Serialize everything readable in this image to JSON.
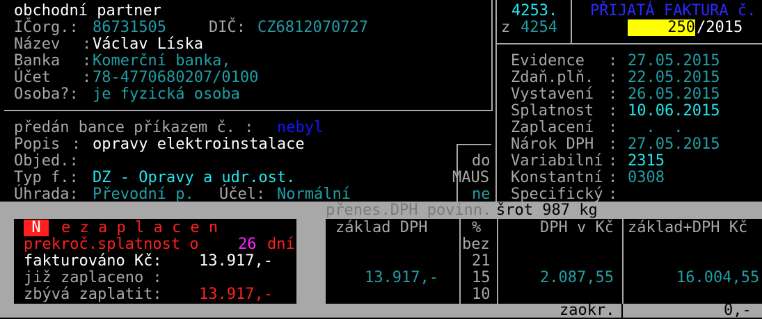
{
  "partner": {
    "heading": "obchodní partner",
    "ico_label": "IČorg.:",
    "ico_value": "86731505",
    "dic_label": "DIČ:",
    "dic_value": "CZ6812070727",
    "name_label": "Název",
    "name_sep": ":",
    "name_value": "Václav Líska",
    "bank_label": "Banka",
    "bank_sep": ":",
    "bank_value": "Komerční banka,",
    "account_label": "Účet",
    "account_sep": ":",
    "account_value": "78-4770680207/0100",
    "person_label": "Osoba?:",
    "person_value": "je fyzická osoba"
  },
  "doc": {
    "number": "4253.",
    "of_label": "z",
    "total": "4254",
    "type_title": "PŘIJATÁ FAKTURA č.",
    "invoice_no": "250",
    "year": "/2015"
  },
  "details": {
    "bank_order_label": "předán bance příkazem č. :",
    "bank_order_value": "nebyl",
    "desc_label": "Popis",
    "desc_sep": ":",
    "desc_value": "opravy elektroinstalace",
    "order_label": "Objed.:",
    "order_value": "",
    "type_label": "Typ f.:",
    "type_value": "DZ - Opravy a udr.ost.",
    "payment_label": "Úhrada:",
    "payment_value": "Převodní p.",
    "purpose_label": "Účel:",
    "purpose_value": "Normální",
    "maus_do": "do",
    "maus_label": "MAUS",
    "maus_value": "ne"
  },
  "dates": [
    {
      "label": "Evidence",
      "sep": ":",
      "value": "27.05.2015",
      "color": "teal"
    },
    {
      "label": "Zdaň.plň.",
      "sep": ":",
      "value": "22.05.2015",
      "color": "teal"
    },
    {
      "label": "Vystavení",
      "sep": ":",
      "value": "26.05.2015",
      "color": "teal"
    },
    {
      "label": "Splatnost",
      "sep": ":",
      "value": "10.06.2015",
      "color": "cyan"
    },
    {
      "label": "Zaplacení",
      "sep": ":",
      "value": "  .  .",
      "color": "teal"
    },
    {
      "label": "Nárok DPH",
      "sep": ":",
      "value": "27.05.2015",
      "color": "teal"
    },
    {
      "label": "Variabilní",
      "sep": ":",
      "value": "2315",
      "color": "cyan"
    },
    {
      "label": "Konstantní",
      "sep": ":",
      "value": "0308",
      "color": "teal"
    },
    {
      "label": "Specifický",
      "sep": ":",
      "value": "",
      "color": "teal"
    }
  ],
  "notes": {
    "vat_transfer": "přenes.DPH povinn.",
    "scrap": "šrot 987 kg"
  },
  "status": {
    "first_letter": "N",
    "rest": "e z a p l a c e n",
    "overdue_label": "prekroč.splatnost o",
    "overdue_days": "26",
    "overdue_unit": "dní",
    "invoiced_label": "fakturováno Kč:",
    "invoiced_value": "13.917,-",
    "paid_label": "již zaplaceno :",
    "paid_value": "",
    "remaining_label": "zbývá zaplatit:",
    "remaining_value": "13.917,-"
  },
  "vat_table": {
    "col_base": "základ DPH",
    "col_pct": "%",
    "col_vat": "DPH v Kč",
    "col_total": "základ+DPH Kč",
    "rates": [
      "bez",
      "21",
      "15",
      "10"
    ],
    "base_value": "13.917,-",
    "vat_value": "2.087,55",
    "total_value": "16.004,55"
  },
  "rounding": {
    "label": "zaokr.",
    "value": "0,-"
  },
  "colors": {
    "grey_panel": "#a8a8a8",
    "highlight_yellow": "#ffff00",
    "status_red": "#ff1f1f"
  }
}
